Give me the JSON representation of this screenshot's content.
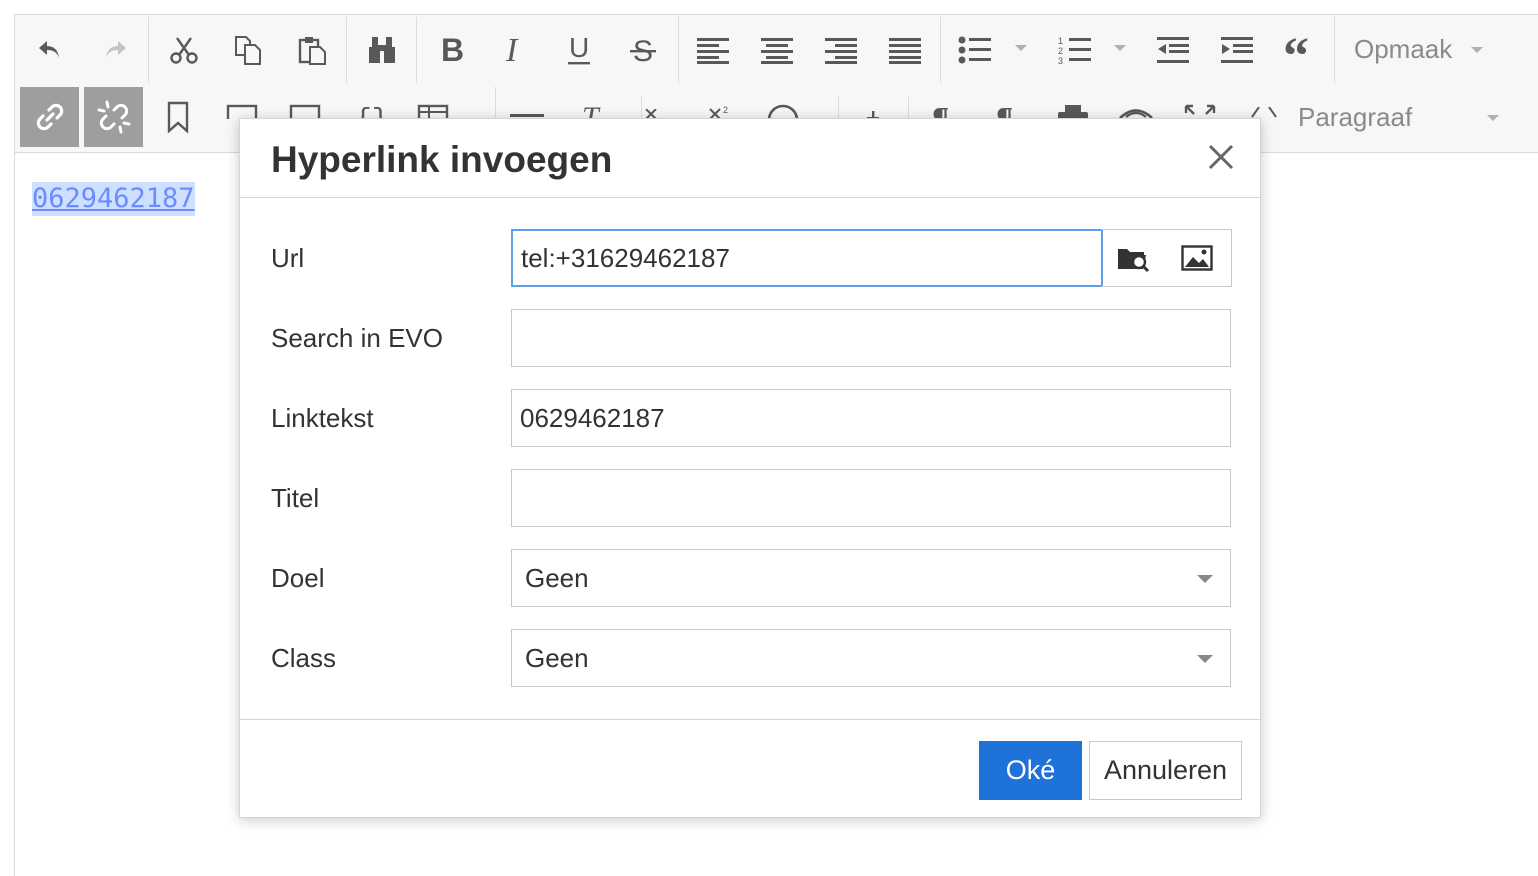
{
  "toolbar": {
    "format_label": "Opmaak",
    "paragraph_label": "Paragraaf"
  },
  "content": {
    "link_text": "0629462187"
  },
  "dialog": {
    "title": "Hyperlink invoegen",
    "fields": {
      "url": {
        "label": "Url",
        "value": "tel:+31629462187"
      },
      "search": {
        "label": "Search in EVO",
        "value": ""
      },
      "linktext": {
        "label": "Linktekst",
        "value": "0629462187"
      },
      "title": {
        "label": "Titel",
        "value": ""
      },
      "target": {
        "label": "Doel",
        "value": "Geen"
      },
      "class": {
        "label": "Class",
        "value": "Geen"
      }
    },
    "ok_label": "Oké",
    "cancel_label": "Annuleren"
  },
  "colors": {
    "accent": "#1e72d8",
    "active_button": "#9e9e9e",
    "focus_border": "#5da0e8",
    "link": "#6b8cff"
  }
}
